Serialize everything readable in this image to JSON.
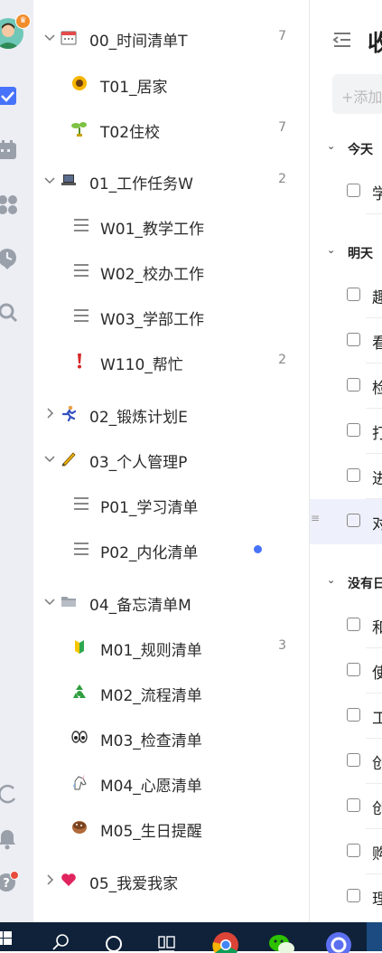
{
  "sidebar_rail": {
    "icons": [
      "avatar",
      "checkbox-icon",
      "calendar-icon",
      "grid-icon",
      "clock-icon",
      "search-icon",
      "sync-icon",
      "bell-icon",
      "help-icon"
    ],
    "accent": "#4772fa"
  },
  "lists": [
    {
      "label": "00_时间清单T",
      "count": "7",
      "icon": "calendar-icon",
      "expanded": true
    },
    {
      "label": "T01_居家",
      "count": "",
      "icon": "sunflower-icon"
    },
    {
      "label": "T02住校",
      "count": "7",
      "icon": "seedling-icon"
    },
    {
      "label": "01_工作任务W",
      "count": "2",
      "icon": "laptop-icon",
      "expanded": true
    },
    {
      "label": "W01_教学工作",
      "count": "",
      "icon": "menu-icon"
    },
    {
      "label": "W02_校办工作",
      "count": "",
      "icon": "menu-icon"
    },
    {
      "label": "W03_学部工作",
      "count": "",
      "icon": "menu-icon"
    },
    {
      "label": "W110_帮忙",
      "count": "2",
      "icon": "exclamation-icon"
    },
    {
      "label": "02_锻炼计划E",
      "count": "",
      "icon": "runner-icon",
      "expanded": false
    },
    {
      "label": "03_个人管理P",
      "count": "",
      "icon": "pencil-icon",
      "expanded": true
    },
    {
      "label": "P01_学习清单",
      "count": "",
      "icon": "menu-icon"
    },
    {
      "label": "P02_内化清单",
      "count": "",
      "icon": "menu-icon",
      "dot": true
    },
    {
      "label": "04_备忘清单M",
      "count": "",
      "icon": "folder-icon",
      "expanded": true
    },
    {
      "label": "M01_规则清单",
      "count": "3",
      "icon": "beginner-icon"
    },
    {
      "label": "M02_流程清单",
      "count": "",
      "icon": "recycle-icon"
    },
    {
      "label": "M03_检查清单",
      "count": "",
      "icon": "eyes-icon"
    },
    {
      "label": "M04_心愿清单",
      "count": "",
      "icon": "unicorn-icon"
    },
    {
      "label": "M05_生日提醒",
      "count": "",
      "icon": "cake-icon"
    },
    {
      "label": "05_我爱我家",
      "count": "",
      "icon": "heart-icon",
      "expanded": false
    }
  ],
  "main": {
    "title": "收",
    "add_placeholder": "+添加",
    "sections": [
      {
        "label": "今天",
        "tasks": [
          "学"
        ]
      },
      {
        "label": "明天",
        "tasks": [
          "趣",
          "看",
          "检",
          "打",
          "进",
          "对"
        ]
      },
      {
        "label": "没有日",
        "tasks": [
          "和",
          "使",
          "工",
          "创",
          "创",
          "购",
          "理"
        ]
      }
    ]
  },
  "taskbar": {
    "icons": [
      "windows-start-icon",
      "search-icon",
      "cortana-icon",
      "task-view-icon",
      "chrome-icon",
      "wechat-icon",
      "app-icon"
    ]
  }
}
